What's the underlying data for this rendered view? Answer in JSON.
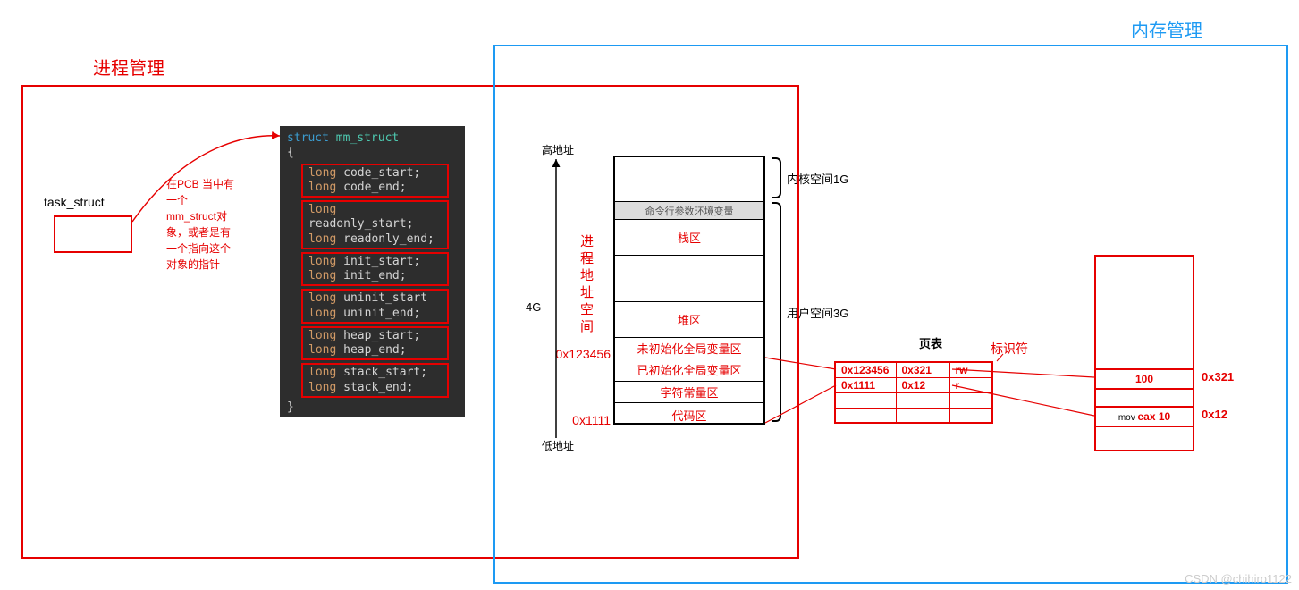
{
  "titles": {
    "process": "进程管理",
    "memory": "内存管理"
  },
  "task": {
    "label": "task_struct",
    "note_l1": "在PCB 当中有",
    "note_l2": "一个",
    "note_l3": "mm_struct对",
    "note_l4": "象，或者是有",
    "note_l5": "一个指向这个",
    "note_l6": "对象的指针"
  },
  "code": {
    "header": "struct mm_struct",
    "open": "{",
    "close": "}",
    "groups": [
      [
        "long code_start;",
        "long code_end;"
      ],
      [
        "long readonly_start;",
        "long readonly_end;"
      ],
      [
        "long init_start;",
        "long init_end;"
      ],
      [
        "long uninit_start",
        "long uninit_end;"
      ],
      [
        "long heap_start;",
        "long heap_end;"
      ],
      [
        "long stack_start;",
        "long stack_end;"
      ]
    ]
  },
  "mem": {
    "high": "高地址",
    "low": "低地址",
    "size": "4G",
    "vlabel": "进程地址空间",
    "kernel_label": "内核空间1G",
    "user_label": "用户空间3G",
    "rows": [
      {
        "text": "",
        "h": 50,
        "cls": ""
      },
      {
        "text": "命令行参数环境变量",
        "h": 20,
        "cls": "",
        "bg": "#ddd"
      },
      {
        "text": "栈区",
        "h": 40,
        "cls": "red"
      },
      {
        "text": "",
        "h": 52,
        "cls": ""
      },
      {
        "text": "堆区",
        "h": 40,
        "cls": "red"
      },
      {
        "text": "未初始化全局变量区",
        "h": 23,
        "cls": "red"
      },
      {
        "text": "已初始化全局变量区",
        "h": 26,
        "cls": "red"
      },
      {
        "text": "字符常量区",
        "h": 24,
        "cls": "red"
      },
      {
        "text": "代码区",
        "h": 26,
        "cls": "red"
      }
    ],
    "addr1": "0x123456",
    "addr2": "0x1111"
  },
  "ptable": {
    "title": "页表",
    "flag": "标识符",
    "rows": [
      [
        "0x123456",
        "0x321",
        "rw"
      ],
      [
        "0x1111",
        "0x12",
        "r"
      ],
      [
        "",
        "",
        ""
      ],
      [
        "",
        "",
        ""
      ]
    ]
  },
  "phys": {
    "row1": "100",
    "row2_pre": "mov ",
    "row2_ins": "eax 10",
    "addr1": "0x321",
    "addr2": "0x12"
  },
  "watermark": "CSDN @chihiro1122"
}
